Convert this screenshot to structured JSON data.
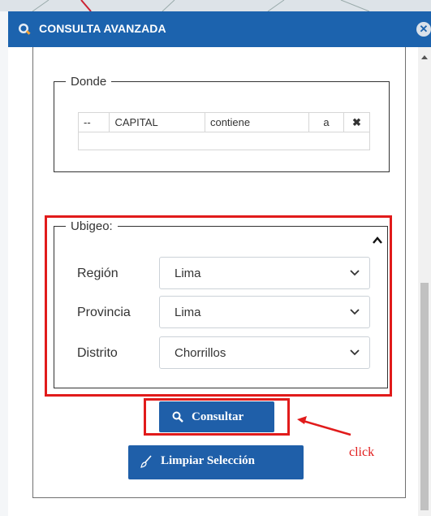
{
  "window": {
    "title": "CONSULTA AVANZADA",
    "title_icon": "search-icon",
    "close_icon": "close-icon",
    "close_glyph": "✕"
  },
  "donde": {
    "legend": "Donde",
    "rows": [
      {
        "op": "--",
        "field": "CAPITAL",
        "comparator": "contiene",
        "value": "a",
        "remove_glyph": "✖"
      }
    ]
  },
  "ubigeo": {
    "legend": "Ubigeo:",
    "region": {
      "label": "Región",
      "value": "Lima"
    },
    "provincia": {
      "label": "Provincia",
      "value": "Lima"
    },
    "distrito": {
      "label": "Distrito",
      "value": "Chorrillos"
    }
  },
  "buttons": {
    "consultar": "Consultar",
    "limpiar": "Limpiar Selección"
  },
  "annotation": {
    "click_text": "click",
    "color": "#e11b1b"
  },
  "colors": {
    "titlebar": "#1c63ae",
    "button": "#1f5fa9"
  }
}
